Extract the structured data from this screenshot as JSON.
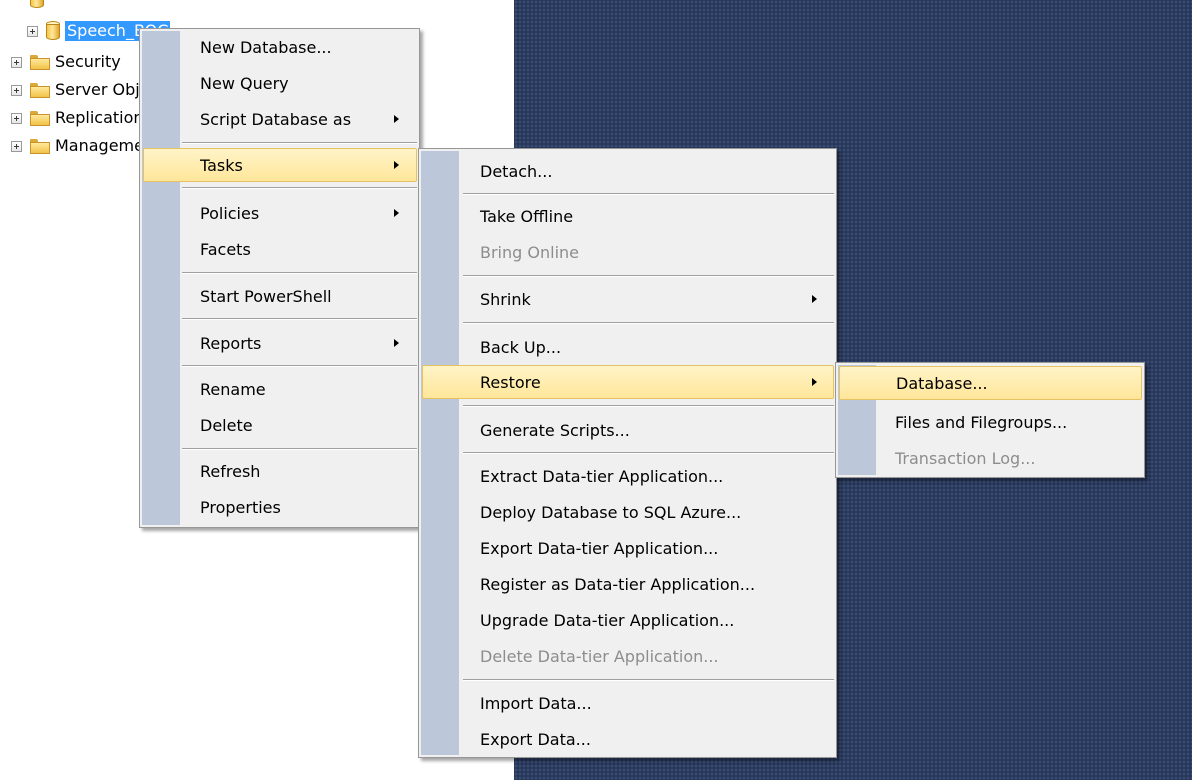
{
  "colors": {
    "dark_background": "#2b3d63",
    "menu_background": "#f0f0f0",
    "menu_gutter": "#bcc8d9",
    "highlight": "#ffe69a",
    "selection": "#3399ff",
    "disabled_text": "#8d8d8d"
  },
  "tree": {
    "selected_label": "Speech_BOC",
    "items": [
      {
        "label": "Security",
        "icon": "folder-icon"
      },
      {
        "label": "Server Objects",
        "icon": "folder-icon"
      },
      {
        "label": "Replication",
        "icon": "folder-icon"
      },
      {
        "label": "Management",
        "icon": "folder-icon"
      }
    ]
  },
  "menus": {
    "database": {
      "items": [
        {
          "label": "New Database..."
        },
        {
          "label": "New Query"
        },
        {
          "label": "Script Database as",
          "submenu": true
        },
        {
          "label": "Tasks",
          "submenu": true,
          "highlighted": true
        },
        {
          "label": "Policies",
          "submenu": true
        },
        {
          "label": "Facets"
        },
        {
          "label": "Start PowerShell"
        },
        {
          "label": "Reports",
          "submenu": true
        },
        {
          "label": "Rename"
        },
        {
          "label": "Delete"
        },
        {
          "label": "Refresh"
        },
        {
          "label": "Properties"
        }
      ]
    },
    "tasks": {
      "items": [
        {
          "label": "Detach..."
        },
        {
          "label": "Take Offline"
        },
        {
          "label": "Bring Online",
          "disabled": true
        },
        {
          "label": "Shrink",
          "submenu": true
        },
        {
          "label": "Back Up..."
        },
        {
          "label": "Restore",
          "submenu": true,
          "highlighted": true
        },
        {
          "label": "Generate Scripts..."
        },
        {
          "label": "Extract Data-tier Application..."
        },
        {
          "label": "Deploy Database to SQL Azure..."
        },
        {
          "label": "Export Data-tier Application..."
        },
        {
          "label": "Register as Data-tier Application..."
        },
        {
          "label": "Upgrade Data-tier Application..."
        },
        {
          "label": "Delete Data-tier Application...",
          "disabled": true
        },
        {
          "label": "Import Data..."
        },
        {
          "label": "Export Data..."
        }
      ]
    },
    "restore": {
      "items": [
        {
          "label": "Database...",
          "highlighted": true
        },
        {
          "label": "Files and Filegroups..."
        },
        {
          "label": "Transaction Log...",
          "disabled": true
        }
      ]
    }
  }
}
